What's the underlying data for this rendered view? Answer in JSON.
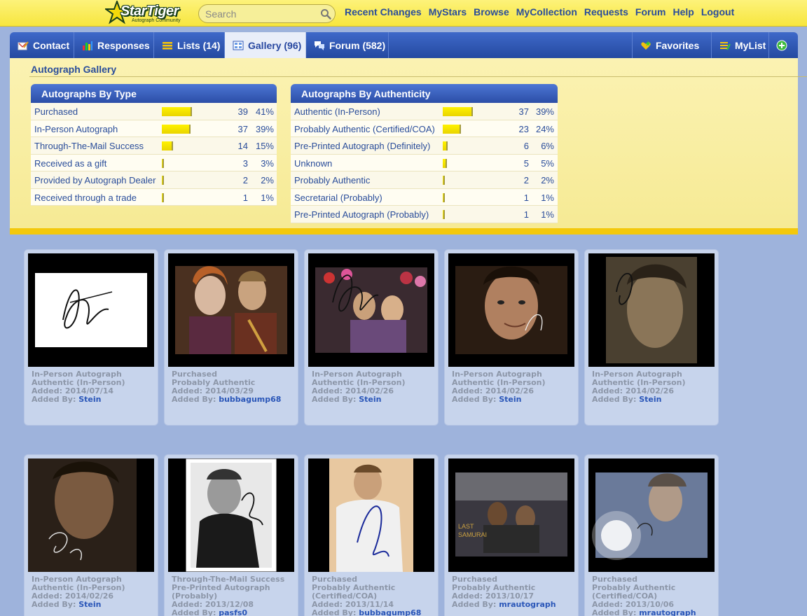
{
  "brand": {
    "name": "StarTiger",
    "tagline": "Autograph Community"
  },
  "search": {
    "placeholder": "Search"
  },
  "top_nav": [
    "Recent Changes",
    "MyStars",
    "Browse",
    "MyCollection",
    "Requests",
    "Forum",
    "Help",
    "Logout"
  ],
  "tabs": [
    {
      "label": "Contact",
      "icon": "contact-icon",
      "active": false
    },
    {
      "label": "Responses",
      "icon": "bar-chart-icon",
      "active": false
    },
    {
      "label": "Lists (14)",
      "icon": "list-icon",
      "active": false
    },
    {
      "label": "Gallery (96)",
      "icon": "gallery-icon",
      "active": true
    },
    {
      "label": "Forum (582)",
      "icon": "speech-bubbles-icon",
      "active": false
    },
    {
      "label": "Favorites",
      "icon": "heart-star-icon",
      "active": false
    },
    {
      "label": "MyList",
      "icon": "list-pencil-icon",
      "active": false
    },
    {
      "label": "",
      "icon": "add-icon",
      "active": false
    }
  ],
  "gallery_title": "Autograph Gallery",
  "by_type": {
    "title": "Autographs By Type",
    "rows": [
      {
        "label": "Purchased",
        "count": "39",
        "percent": "41%",
        "fraction": 0.41
      },
      {
        "label": "In-Person Autograph",
        "count": "37",
        "percent": "39%",
        "fraction": 0.39
      },
      {
        "label": "Through-The-Mail Success",
        "count": "14",
        "percent": "15%",
        "fraction": 0.15
      },
      {
        "label": "Received as a gift",
        "count": "3",
        "percent": "3%",
        "fraction": 0.03
      },
      {
        "label": "Provided by Autograph Dealer",
        "count": "2",
        "percent": "2%",
        "fraction": 0.02
      },
      {
        "label": "Received through a trade",
        "count": "1",
        "percent": "1%",
        "fraction": 0.01
      }
    ]
  },
  "by_authenticity": {
    "title": "Autographs By Authenticity",
    "rows": [
      {
        "label": "Authentic (In-Person)",
        "count": "37",
        "percent": "39%",
        "fraction": 0.39
      },
      {
        "label": "Probably Authentic (Certified/COA)",
        "count": "23",
        "percent": "24%",
        "fraction": 0.24
      },
      {
        "label": "Pre-Printed Autograph (Definitely)",
        "count": "6",
        "percent": "6%",
        "fraction": 0.06
      },
      {
        "label": "Unknown",
        "count": "5",
        "percent": "5%",
        "fraction": 0.05
      },
      {
        "label": "Probably Authentic",
        "count": "2",
        "percent": "2%",
        "fraction": 0.02
      },
      {
        "label": "Secretarial (Probably)",
        "count": "1",
        "percent": "1%",
        "fraction": 0.01
      },
      {
        "label": "Pre-Printed Autograph (Probably)",
        "count": "1",
        "percent": "1%",
        "fraction": 0.01
      }
    ]
  },
  "added_by_label": "Added By:",
  "items": [
    {
      "type": "In-Person Autograph",
      "auth": [
        "Authentic (In-Person)"
      ],
      "added": "Added: 2014/07/14",
      "user": "Stein"
    },
    {
      "type": "Purchased",
      "auth": [
        "Probably Authentic"
      ],
      "added": "Added: 2014/03/29",
      "user": "bubbagump68"
    },
    {
      "type": "In-Person Autograph",
      "auth": [
        "Authentic (In-Person)"
      ],
      "added": "Added: 2014/02/26",
      "user": "Stein"
    },
    {
      "type": "In-Person Autograph",
      "auth": [
        "Authentic (In-Person)"
      ],
      "added": "Added: 2014/02/26",
      "user": "Stein"
    },
    {
      "type": "In-Person Autograph",
      "auth": [
        "Authentic (In-Person)"
      ],
      "added": "Added: 2014/02/26",
      "user": "Stein"
    },
    {
      "type": "In-Person Autograph",
      "auth": [
        "Authentic (In-Person)"
      ],
      "added": "Added: 2014/02/26",
      "user": "Stein"
    },
    {
      "type": "Through-The-Mail Success",
      "auth": [
        "Pre-Printed Autograph",
        "(Probably)"
      ],
      "added": "Added: 2013/12/08",
      "user": "pasfs0"
    },
    {
      "type": "Purchased",
      "auth": [
        "Probably Authentic",
        "(Certified/COA)"
      ],
      "added": "Added: 2013/11/14",
      "user": "bubbagump68"
    },
    {
      "type": "Purchased",
      "auth": [
        "Probably Authentic"
      ],
      "added": "Added: 2013/10/17",
      "user": "mrautograph"
    },
    {
      "type": "Purchased",
      "auth": [
        "Probably Authentic",
        "(Certified/COA)"
      ],
      "added": "Added: 2013/10/06",
      "user": "mrautograph"
    }
  ]
}
